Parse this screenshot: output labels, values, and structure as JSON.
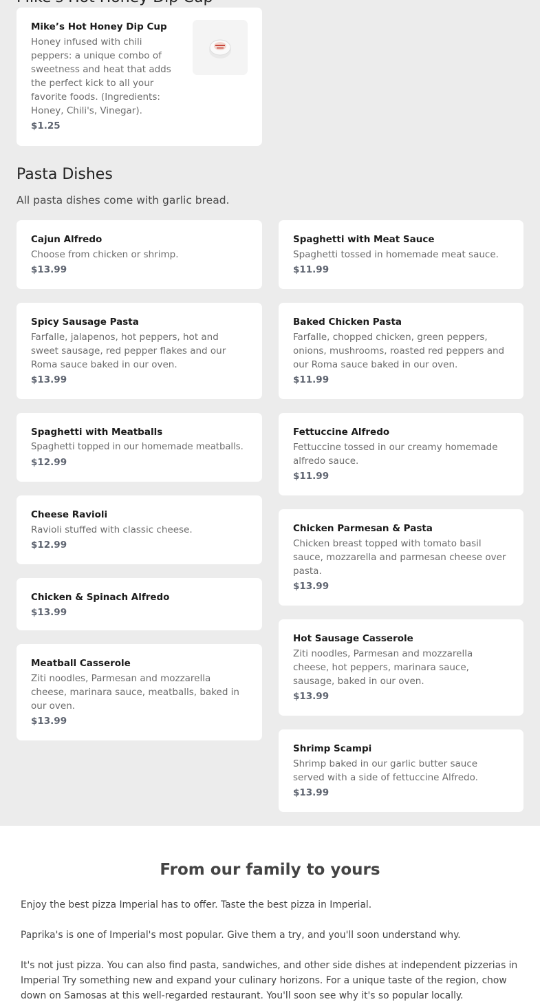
{
  "top_item": {
    "heading_cut": "Mike's Hot Honey Dip Cup",
    "name": "Mike’s Hot Honey Dip Cup",
    "desc": "Honey infused with chili peppers: a unique combo of sweetness and heat that adds the perfect kick to all your favorite foods. (Ingredients: Honey, Chili's, Vinegar).",
    "price": "$1.25"
  },
  "pasta": {
    "title": "Pasta Dishes",
    "subtitle": "All pasta dishes come with garlic bread.",
    "items": [
      {
        "name": "Cajun Alfredo",
        "desc": "Choose from chicken or shrimp.",
        "price": "$13.99"
      },
      {
        "name": "Spaghetti with Meat Sauce",
        "desc": "Spaghetti tossed in homemade meat sauce.",
        "price": "$11.99"
      },
      {
        "name": "Spicy Sausage Pasta",
        "desc": "Farfalle, jalapenos, hot peppers, hot and sweet sausage, red pepper flakes and our Roma sauce baked in our oven.",
        "price": "$13.99"
      },
      {
        "name": "Baked Chicken Pasta",
        "desc": "Farfalle, chopped chicken, green peppers, onions, mushrooms, roasted red peppers and our Roma sauce baked in our oven.",
        "price": "$11.99"
      },
      {
        "name": "Spaghetti with Meatballs",
        "desc": "Spaghetti topped in our homemade meatballs.",
        "price": "$12.99"
      },
      {
        "name": "Fettuccine Alfredo",
        "desc": "Fettuccine tossed in our creamy homemade alfredo sauce.",
        "price": "$11.99"
      },
      {
        "name": "Cheese Ravioli",
        "desc": "Ravioli stuffed with classic cheese.",
        "price": "$12.99"
      },
      {
        "name": "Chicken Parmesan & Pasta",
        "desc": "Chicken breast topped with tomato basil sauce, mozzarella and parmesan cheese over pasta.",
        "price": "$13.99"
      },
      {
        "name": "Chicken & Spinach Alfredo",
        "desc": "",
        "price": "$13.99"
      },
      {
        "name": "Hot Sausage Casserole",
        "desc": "Ziti noodles, Parmesan and mozzarella cheese, hot peppers, marinara sauce, sausage, baked in our oven.",
        "price": "$13.99"
      },
      {
        "name": "Meatball Casserole",
        "desc": "Ziti noodles, Parmesan and mozzarella cheese, marinara sauce, meatballs, baked in our oven.",
        "price": "$13.99"
      },
      {
        "name": "Shrimp Scampi",
        "desc": "Shrimp baked in our garlic butter sauce served with a side of fettuccine Alfredo.",
        "price": "$13.99"
      }
    ]
  },
  "footer": {
    "title": "From our family to yours",
    "p1": "Enjoy the best pizza Imperial has to offer. Taste the best pizza in Imperial.",
    "p2": "Paprika's is one of Imperial's most popular. Give them a try, and you'll soon understand why.",
    "p3": "It's not just pizza. You can also find pasta, sandwiches, and other side dishes at independent pizzerias in Imperial Try something new and expand your culinary horizons. For a unique taste of the region, chow down on Samosas at this well-regarded restaurant. You'll soon see why it's so popular locally."
  }
}
